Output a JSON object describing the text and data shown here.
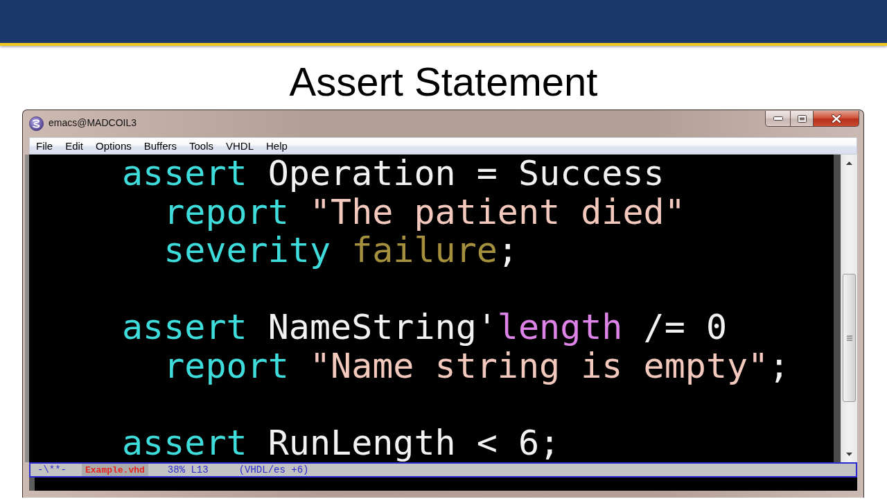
{
  "slide": {
    "title": "Assert Statement"
  },
  "window": {
    "title": "emacs@MADCOIL3"
  },
  "menu_bar": [
    "File",
    "Edit",
    "Options",
    "Buffers",
    "Tools",
    "VHDL",
    "Help"
  ],
  "editor": {
    "statements": [
      {
        "segments": [
          {
            "kind": "keyword",
            "text": "assert"
          },
          {
            "kind": "plain",
            "text": " Operation = Success"
          }
        ],
        "children": [
          {
            "segments": [
              {
                "kind": "keyword",
                "text": "report"
              },
              {
                "kind": "string",
                "text": " \"The patient died\""
              }
            ]
          },
          {
            "segments": [
              {
                "kind": "keyword",
                "text": "severity"
              },
              {
                "kind": "constant",
                "text": " failure"
              },
              {
                "kind": "plain",
                "text": ";"
              }
            ]
          }
        ]
      },
      {
        "segments": [
          {
            "kind": "keyword",
            "text": "assert"
          },
          {
            "kind": "plain",
            "text": " NameString'"
          },
          {
            "kind": "attribute",
            "text": "length"
          },
          {
            "kind": "plain",
            "text": " /= 0"
          }
        ],
        "children": [
          {
            "segments": [
              {
                "kind": "keyword",
                "text": "report"
              },
              {
                "kind": "string",
                "text": " \"Name string is empty\""
              },
              {
                "kind": "plain",
                "text": ";"
              }
            ]
          }
        ]
      },
      {
        "segments": [
          {
            "kind": "keyword",
            "text": "assert"
          },
          {
            "kind": "plain",
            "text": " RunLength < 6;"
          }
        ]
      }
    ]
  },
  "mode_line": {
    "status": "-\\**-",
    "buffer_name": "Example.vhd",
    "position": "38% L13",
    "mode": "(VHDL/es +6)"
  }
}
